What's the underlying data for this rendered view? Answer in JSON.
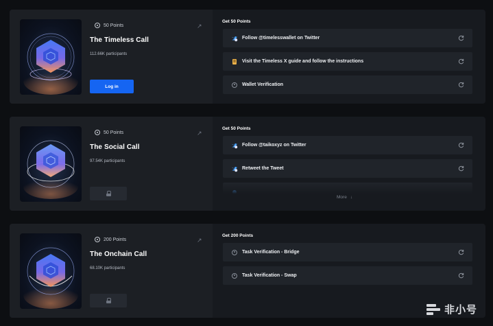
{
  "campaigns": [
    {
      "points": "50 Points",
      "title": "The Timeless Call",
      "participants": "112.66K participants",
      "action_label": "Log in",
      "action_type": "login",
      "section_title": "Get 50 Points",
      "tasks": [
        {
          "label": "Follow @timelesswallet on Twitter",
          "icon": "twitter-bird-icon"
        },
        {
          "label": "Visit the Timeless X guide and follow the instructions",
          "icon": "guide-icon"
        },
        {
          "label": "Wallet Verification",
          "icon": "verification-icon"
        }
      ],
      "more_label": ""
    },
    {
      "points": "50 Points",
      "title": "The Social Call",
      "participants": "97.54K participants",
      "action_label": "",
      "action_type": "locked",
      "section_title": "Get 50 Points",
      "tasks": [
        {
          "label": "Follow @taikoxyz on Twitter",
          "icon": "twitter-bird-icon"
        },
        {
          "label": "Retweet the Tweet",
          "icon": "twitter-bird-icon"
        },
        {
          "label": "",
          "icon": "twitter-bird-icon"
        }
      ],
      "more_label": "More"
    },
    {
      "points": "200 Points",
      "title": "The Onchain Call",
      "participants": "68.10K participants",
      "action_label": "",
      "action_type": "locked",
      "section_title": "Get 200 Points",
      "tasks": [
        {
          "label": "Task Verification - Bridge",
          "icon": "verification-icon"
        },
        {
          "label": "Task Verification - Swap",
          "icon": "verification-icon"
        }
      ],
      "more_label": ""
    }
  ],
  "watermark": {
    "text": "非小号"
  },
  "colors": {
    "accent": "#1565f2",
    "background": "#0d0f12",
    "card": "#171a1f",
    "task": "#20242a"
  }
}
